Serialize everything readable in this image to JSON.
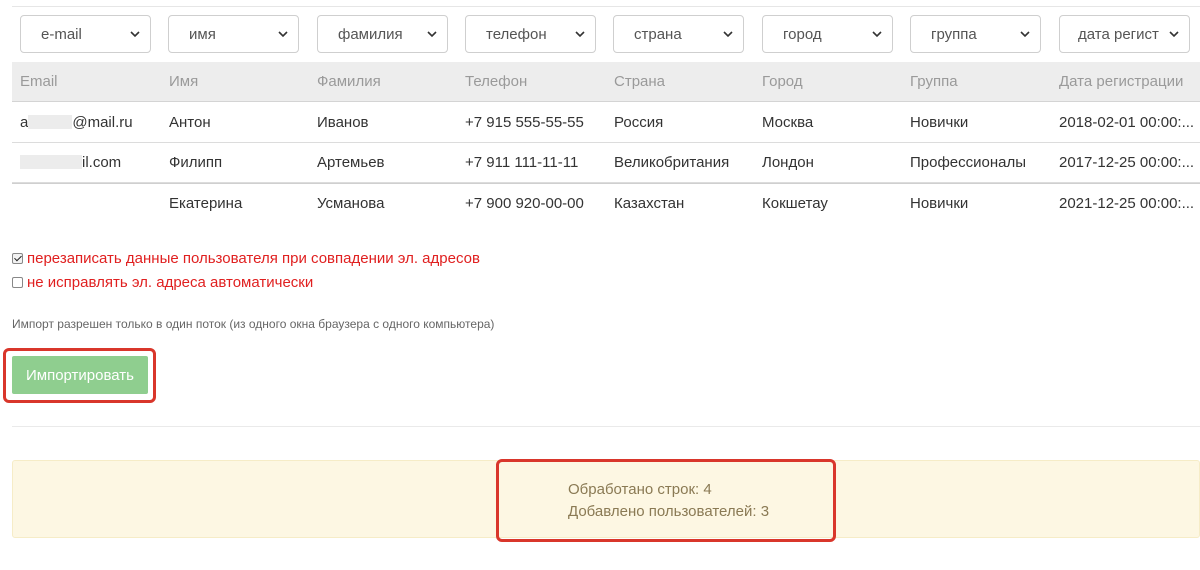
{
  "mapping_selects": [
    {
      "value": "e-mail"
    },
    {
      "value": "имя"
    },
    {
      "value": "фамилия"
    },
    {
      "value": "телефон"
    },
    {
      "value": "страна"
    },
    {
      "value": "город"
    },
    {
      "value": "группа"
    },
    {
      "value": "дата регист"
    }
  ],
  "table": {
    "headers": [
      "Email",
      "Имя",
      "Фамилия",
      "Телефон",
      "Страна",
      "Город",
      "Группа",
      "Дата регистрации"
    ],
    "rows": [
      {
        "email_prefix": "a",
        "email_suffix": "@mail.ru",
        "first_name": "Антон",
        "last_name": "Иванов",
        "phone": "+7 915 555-55-55",
        "country": "Россия",
        "city": "Москва",
        "group": "Новички",
        "registered": "2018-02-01 00:00:..."
      },
      {
        "email_prefix": "",
        "email_suffix": "il.com",
        "first_name": "Филипп",
        "last_name": "Артемьев",
        "phone": "+7 911 111-11-11",
        "country": "Великобритания",
        "city": "Лондон",
        "group": "Профессионалы",
        "registered": "2017-12-25 00:00:..."
      },
      {
        "email_prefix": "",
        "email_suffix": "",
        "first_name": "Екатерина",
        "last_name": "Усманова",
        "phone": "+7 900 920-00-00",
        "country": "Казахстан",
        "city": "Кокшетау",
        "group": "Новички",
        "registered": "2021-12-25 00:00:..."
      }
    ]
  },
  "options": {
    "overwrite": {
      "label": "перезаписать данные пользователя при совпадении эл. адресов",
      "checked": true
    },
    "no_autofix": {
      "label": "не исправлять эл. адреса автоматически",
      "checked": false
    }
  },
  "note": "Импорт разрешен только в один поток (из одного окна браузера с одного компьютера)",
  "import_button": "Импортировать",
  "result": {
    "processed": "Обработано строк: 4",
    "added": "Добавлено пользователей: 3"
  },
  "colors": {
    "button": "#8fce8f",
    "highlight": "#d9362b",
    "option_text": "#e02020",
    "result_bg": "#fdf7e3"
  },
  "icons": [
    "chevron-down-icon",
    "checkbox-checked-icon",
    "checkbox-empty-icon"
  ]
}
